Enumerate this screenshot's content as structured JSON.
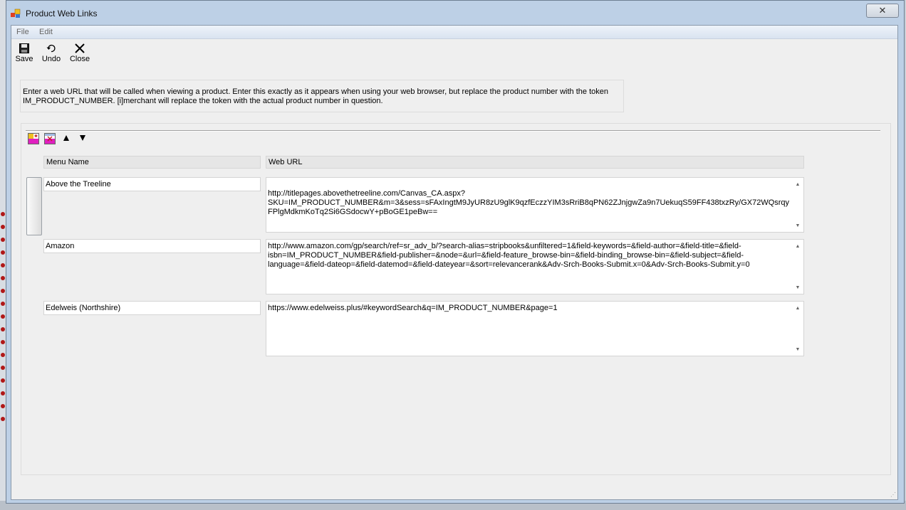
{
  "window": {
    "title": "Product Web Links",
    "close_glyph": "✕"
  },
  "menu": [
    "File",
    "Edit"
  ],
  "toolbar": {
    "save": "Save",
    "undo": "Undo",
    "close": "Close"
  },
  "instructions": "Enter a web URL that will be called when viewing a product. Enter this exactly as it appears when using your web browser, but replace the product number with the token IM_PRODUCT_NUMBER. [i]merchant will replace the token with the actual product number in question.",
  "grid": {
    "headers": {
      "menu_name": "Menu Name",
      "web_url": "Web URL"
    },
    "tools": [
      "add-row-icon",
      "delete-row-icon",
      "move-up-icon",
      "move-down-icon"
    ],
    "rows": [
      {
        "name": "Above the Treeline",
        "url": "http://titlepages.abovethetreeline.com/Canvas_CA.aspx?SKU=IM_PRODUCT_NUMBER&m=3&sess=sFAxIngtM9JyUR8zU9glK9qzfEczzYIM3sRriB8qPN62ZJnjgwZa9n7UekuqS59FF438txzRy/GX72WQsrqyFPlgMdkmKoTq2Si6GSdocwY+pBoGE1peBw=="
      },
      {
        "name": "Amazon",
        "url": "http://www.amazon.com/gp/search/ref=sr_adv_b/?search-alias=stripbooks&unfiltered=1&field-keywords=&field-author=&field-title=&field-isbn=IM_PRODUCT_NUMBER&field-publisher=&node=&url=&field-feature_browse-bin=&field-binding_browse-bin=&field-subject=&field-language=&field-dateop=&field-datemod=&field-dateyear=&sort=relevancerank&Adv-Srch-Books-Submit.x=0&Adv-Srch-Books-Submit.y=0"
      },
      {
        "name": "Edelweis (Northshire)",
        "url": "https://www.edelweiss.plus/#keywordSearch&q=IM_PRODUCT_NUMBER&page=1"
      }
    ]
  },
  "colors": {
    "title_bg": "#bdd0e6",
    "client_bg": "#efefef",
    "accent_magenta": "#e020c0",
    "accent_yellow": "#f0c020"
  }
}
